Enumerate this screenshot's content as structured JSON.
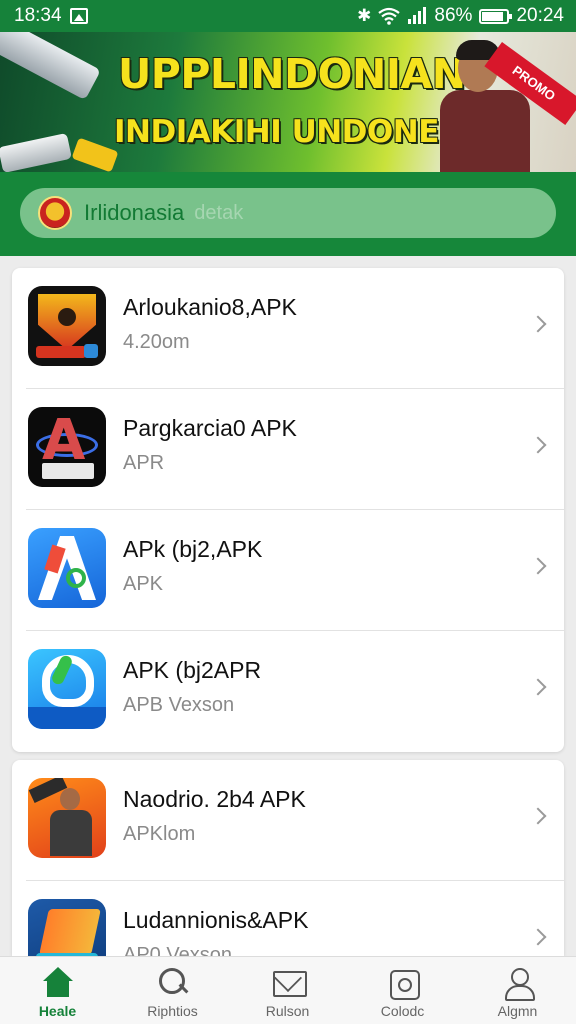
{
  "status_bar": {
    "time_left": "18:34",
    "battery_percent": "86%",
    "battery_level": 0.86,
    "time_right": "20:24",
    "icons": [
      "image-icon",
      "bluetooth-icon",
      "wifi-icon",
      "signal-icon",
      "battery-icon"
    ]
  },
  "banner": {
    "line1": "UPPLINDONIAN",
    "line2": "INDIAKIHI UNDONESIA",
    "ribbon": "PROMO"
  },
  "search": {
    "label": "Irlidonasia",
    "placeholder": "detak"
  },
  "apps": [
    {
      "title": "Arloukanio8,APK",
      "subtitle": "4.20om",
      "icon": "shield-app-icon"
    },
    {
      "title": "Pargkarcia0 APK",
      "subtitle": "APR",
      "icon": "dark-a-app-icon"
    },
    {
      "title": "APk (bj2,APK",
      "subtitle": "APK",
      "icon": "blue-a-app-icon"
    },
    {
      "title": "APK (bj2APR",
      "subtitle": "APB Vexson",
      "icon": "cyan-a-app-icon"
    },
    {
      "title": "Naodrio. 2b4 APK",
      "subtitle": "APKlom",
      "icon": "orange-person-app-icon"
    },
    {
      "title": "Ludannionis&APK",
      "subtitle": "AP0 Vexson",
      "icon": "teal-sheet-app-icon"
    }
  ],
  "nav": {
    "items": [
      {
        "label": "Heale",
        "icon": "home-icon",
        "active": true
      },
      {
        "label": "Riphtios",
        "icon": "search-icon",
        "active": false
      },
      {
        "label": "Rulson",
        "icon": "mail-icon",
        "active": false
      },
      {
        "label": "Colodc",
        "icon": "box-icon",
        "active": false
      },
      {
        "label": "Algmn",
        "icon": "user-icon",
        "active": false
      }
    ]
  },
  "colors": {
    "brand_green": "#16823a",
    "search_fill": "#79c28b",
    "banner_text": "#f6e21d"
  }
}
